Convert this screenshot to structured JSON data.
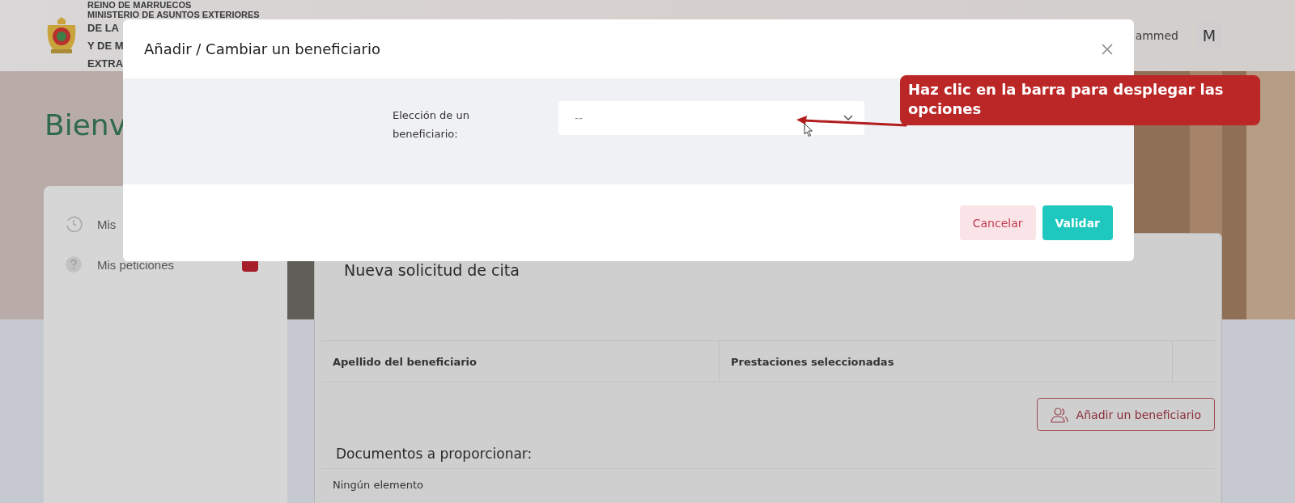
{
  "header": {
    "org_lines": [
      "REINO DE MARRUECOS",
      "MINISTERIO DE ASUNTOS EXTERIORES",
      "DE LA",
      "Y DE M",
      "EXTRA"
    ],
    "user_name": "ammed",
    "avatar": "M"
  },
  "hero": {
    "heading": "Bienv"
  },
  "sidebar": {
    "items": [
      {
        "label": "Mis",
        "kind": "history",
        "badge": false
      },
      {
        "label": "Mis peticiones",
        "kind": "help",
        "badge": true
      }
    ]
  },
  "main": {
    "title": "Nueva solicitud de cita",
    "table": {
      "columns": [
        "Apellido del beneficiario",
        "Prestaciones seleccionadas"
      ]
    },
    "add_button": "Añadir un beneficiario",
    "documents_title": "Documentos a proporcionar:",
    "documents_empty": "Ningún elemento"
  },
  "modal": {
    "title": "Añadir / Cambiar un beneficiario",
    "field": {
      "label": "Elección de un beneficiario:",
      "value": "--"
    },
    "buttons": [
      {
        "label": "Cancelar",
        "kind": "secondary"
      },
      {
        "label": "Validar",
        "kind": "primary"
      }
    ]
  },
  "annotation": {
    "text": "Haz clic en la barra para desplegar las opciones"
  }
}
